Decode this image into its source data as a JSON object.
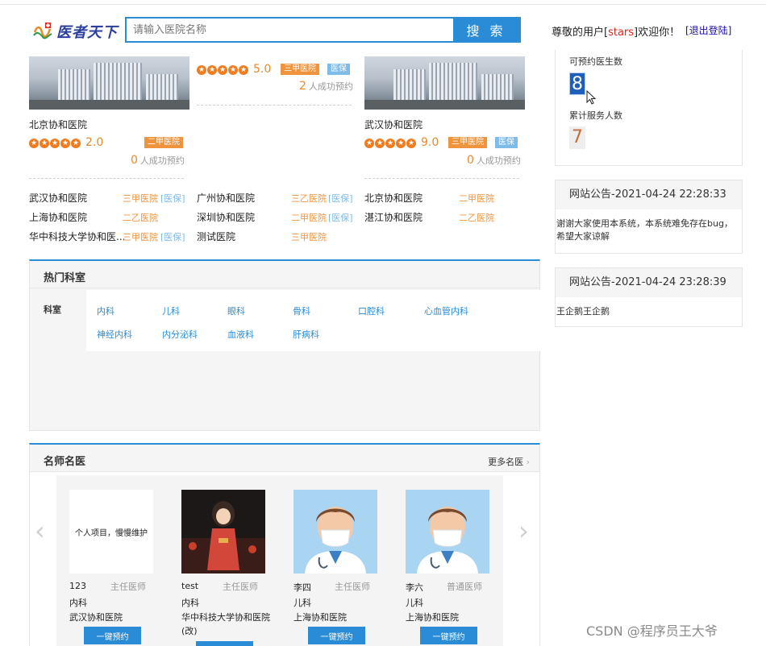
{
  "header": {
    "logo_text": "医者天下",
    "search_placeholder": "请输入医院名称",
    "search_button": "搜 索",
    "welcome_prefix": "尊敬的用户[",
    "welcome_user": "stars",
    "welcome_suffix": "]欢迎你！",
    "logout": "[退出登陆]"
  },
  "hospital_cards": [
    {
      "name": "北京协和医院",
      "score": "2.0",
      "level": "二甲医院",
      "insurance": "",
      "booked": "0",
      "booked_label": "人成功预约"
    },
    {
      "name": "",
      "score": "5.0",
      "level": "三甲医院",
      "insurance": "医保",
      "booked": "2",
      "booked_label": "人成功预约"
    },
    {
      "name": "武汉协和医院",
      "score": "9.0",
      "level": "三甲医院",
      "insurance": "医保",
      "booked": "0",
      "booked_label": "人成功预约"
    }
  ],
  "hospital_list": [
    {
      "name": "武汉协和医院",
      "level": "三甲医院",
      "insurance": "[医保]"
    },
    {
      "name": "广州协和医院",
      "level": "三乙医院",
      "insurance": "[医保]"
    },
    {
      "name": "北京协和医院",
      "level": "二甲医院",
      "insurance": ""
    },
    {
      "name": "上海协和医院",
      "level": "二乙医院",
      "insurance": ""
    },
    {
      "name": "深圳协和医院",
      "level": "二甲医院",
      "insurance": "[医保]"
    },
    {
      "name": "湛江协和医院",
      "level": "二乙医院",
      "insurance": ""
    },
    {
      "name": "华中科技大学协和医...",
      "level": "三甲医院",
      "insurance": "[医保]"
    },
    {
      "name": "测试医院",
      "level": "三甲医院",
      "insurance": ""
    }
  ],
  "departments": {
    "title": "热门科室",
    "label": "科室",
    "items": [
      "内科",
      "儿科",
      "眼科",
      "骨科",
      "口腔科",
      "心血管内科",
      "神经内科",
      "内分泌科",
      "血液科",
      "肝病科"
    ]
  },
  "doctors": {
    "title": "名师名医",
    "more": "更多名医",
    "book_label": "一键预约",
    "items": [
      {
        "name": "123",
        "title": "主任医师",
        "dept": "内科",
        "hospital": "武汉协和医院",
        "photo_text": "个人项目，慢慢维护"
      },
      {
        "name": "test",
        "title": "主任医师",
        "dept": "内科",
        "hospital": "华中科技大学协和医院(改)",
        "photo_text": ""
      },
      {
        "name": "李四",
        "title": "主任医师",
        "dept": "儿科",
        "hospital": "上海协和医院",
        "photo_text": ""
      },
      {
        "name": "李六",
        "title": "普通医师",
        "dept": "儿科",
        "hospital": "上海协和医院",
        "photo_text": ""
      }
    ]
  },
  "stats": {
    "doctors_label": "可预约医生数",
    "doctors_value": "8",
    "served_label": "累计服务人数",
    "served_value": "7"
  },
  "notices": [
    {
      "title": "网站公告-2021-04-24 22:28:33",
      "body": "谢谢大家使用本系统，本系统难免存在bug，希望大家谅解"
    },
    {
      "title": "网站公告-2021-04-24 23:28:39",
      "body": "王企鹅王企鹅"
    }
  ],
  "watermark": "CSDN @程序员王大爷",
  "colors": {
    "accent": "#2a8bd6",
    "orange": "#f0933d",
    "insurance": "#7fbbe9",
    "score": "#e8892b"
  }
}
